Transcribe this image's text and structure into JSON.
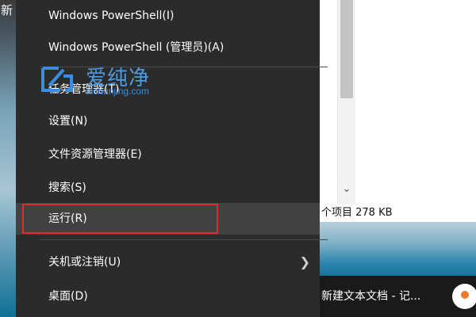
{
  "desktop": {
    "edge_text": "新",
    "accent_color": "#e02b2b"
  },
  "menu": {
    "items": [
      {
        "label": "Windows PowerShell(I)"
      },
      {
        "label": "Windows PowerShell (管理员)(A)"
      },
      {
        "label": "任务管理器(T)"
      },
      {
        "label": "设置(N)"
      },
      {
        "label": "文件资源管理器(E)"
      },
      {
        "label": "搜索(S)"
      },
      {
        "label": "运行(R)"
      },
      {
        "label": "关机或注销(U)"
      },
      {
        "label": "桌面(D)"
      }
    ],
    "submenu_icon": "chevron-right-icon"
  },
  "explorer": {
    "status_text": "个项目  278 KB",
    "scroll_down_icon": "chevron-down-icon"
  },
  "taskbar": {
    "item_label": "新建文本文档 - 记..."
  },
  "watermark": {
    "brand": "爱纯净",
    "url": "aichunjing.com"
  }
}
